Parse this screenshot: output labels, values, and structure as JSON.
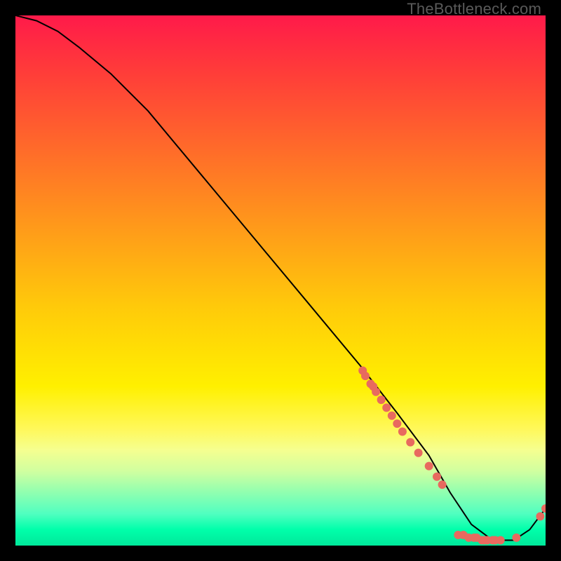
{
  "watermark": "TheBottleneck.com",
  "chart_data": {
    "type": "line",
    "title": "",
    "xlabel": "",
    "ylabel": "",
    "xlim": [
      0,
      100
    ],
    "ylim": [
      0,
      100
    ],
    "grid": false,
    "legend": false,
    "series": [
      {
        "name": "curve",
        "x": [
          0,
          4,
          8,
          12,
          18,
          25,
          35,
          45,
          55,
          65,
          72,
          78,
          82,
          86,
          90,
          94,
          97,
          100
        ],
        "y": [
          100,
          99,
          97,
          94,
          89,
          82,
          70,
          58,
          46,
          34,
          25,
          17,
          10,
          4,
          1,
          1,
          3,
          7
        ]
      }
    ],
    "scatter_points": [
      {
        "x": 65.5,
        "y": 33.0
      },
      {
        "x": 66.0,
        "y": 32.0
      },
      {
        "x": 67.0,
        "y": 30.5
      },
      {
        "x": 67.5,
        "y": 30.0
      },
      {
        "x": 68.0,
        "y": 29.0
      },
      {
        "x": 69.0,
        "y": 27.5
      },
      {
        "x": 70.0,
        "y": 26.0
      },
      {
        "x": 71.0,
        "y": 24.5
      },
      {
        "x": 72.0,
        "y": 23.0
      },
      {
        "x": 73.0,
        "y": 21.5
      },
      {
        "x": 74.5,
        "y": 19.5
      },
      {
        "x": 76.0,
        "y": 17.5
      },
      {
        "x": 78.0,
        "y": 15.0
      },
      {
        "x": 79.5,
        "y": 13.0
      },
      {
        "x": 80.5,
        "y": 11.5
      },
      {
        "x": 83.5,
        "y": 2.0
      },
      {
        "x": 84.5,
        "y": 2.0
      },
      {
        "x": 85.5,
        "y": 1.5
      },
      {
        "x": 86.5,
        "y": 1.5
      },
      {
        "x": 87.0,
        "y": 1.5
      },
      {
        "x": 88.0,
        "y": 1.0
      },
      {
        "x": 88.5,
        "y": 1.0
      },
      {
        "x": 89.0,
        "y": 1.0
      },
      {
        "x": 90.0,
        "y": 1.0
      },
      {
        "x": 90.5,
        "y": 1.0
      },
      {
        "x": 91.5,
        "y": 1.0
      },
      {
        "x": 94.5,
        "y": 1.5
      },
      {
        "x": 99.0,
        "y": 5.5
      },
      {
        "x": 100.0,
        "y": 7.0
      }
    ]
  }
}
